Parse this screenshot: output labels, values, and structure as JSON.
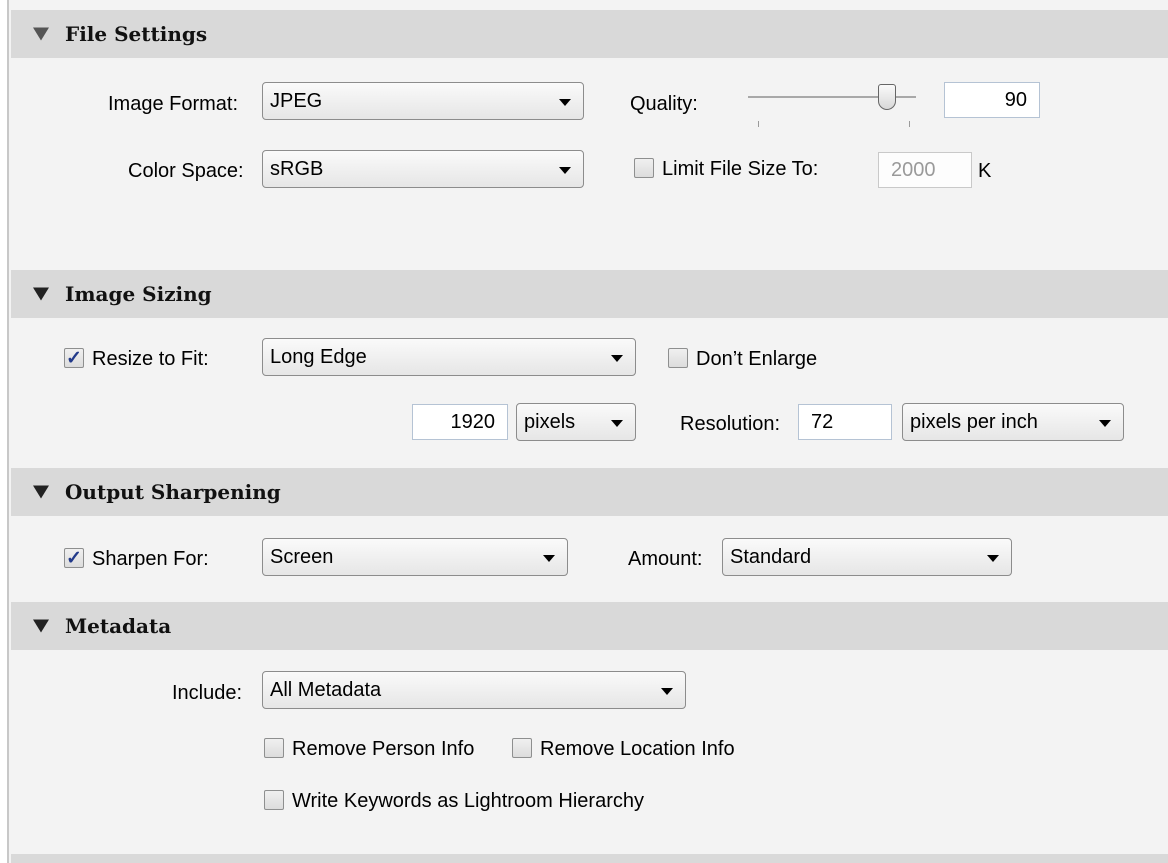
{
  "sections": {
    "file_settings": {
      "title": "File Settings",
      "image_format_label": "Image Format:",
      "image_format_value": "JPEG",
      "quality_label": "Quality:",
      "quality_value": "90",
      "quality_level": 90,
      "color_space_label": "Color Space:",
      "color_space_value": "sRGB",
      "limit_file_size_label": "Limit File Size To:",
      "limit_file_size_checked": false,
      "limit_file_size_value": "2000",
      "limit_file_size_unit": "K"
    },
    "image_sizing": {
      "title": "Image Sizing",
      "resize_to_fit_label": "Resize to Fit:",
      "resize_to_fit_checked": true,
      "resize_mode_value": "Long Edge",
      "dont_enlarge_label": "Don’t Enlarge",
      "dont_enlarge_checked": false,
      "size_value": "1920",
      "size_unit_value": "pixels",
      "resolution_label": "Resolution:",
      "resolution_value": "72",
      "resolution_unit_value": "pixels per inch"
    },
    "output_sharpening": {
      "title": "Output Sharpening",
      "sharpen_for_label": "Sharpen For:",
      "sharpen_for_checked": true,
      "sharpen_for_value": "Screen",
      "amount_label": "Amount:",
      "amount_value": "Standard"
    },
    "metadata": {
      "title": "Metadata",
      "include_label": "Include:",
      "include_value": "All Metadata",
      "remove_person_label": "Remove Person Info",
      "remove_person_checked": false,
      "remove_location_label": "Remove Location Info",
      "remove_location_checked": false,
      "write_keywords_label": "Write Keywords as Lightroom Hierarchy",
      "write_keywords_checked": false
    }
  },
  "icons": {
    "section_toggle": "triangle-down-icon",
    "dropdown_arrow": "chevron-down-icon",
    "checkmark": "checkmark-icon"
  },
  "colors": {
    "panel_background": "#f3f3f3",
    "section_header": "#d9d9d9",
    "checkmark": "#223a8a"
  }
}
